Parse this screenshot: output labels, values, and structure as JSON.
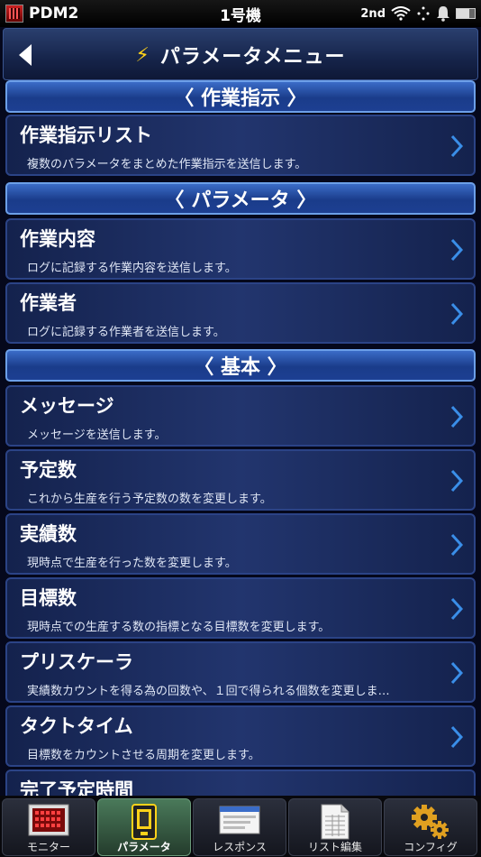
{
  "status_bar": {
    "app_name": "PDM2",
    "device": "1号機",
    "network": "2nd"
  },
  "header": {
    "title": "パラメータメニュー"
  },
  "sections": [
    {
      "title": "〈 作業指示 〉",
      "items": [
        {
          "title": "作業指示リスト",
          "desc": "複数のパラメータをまとめた作業指示を送信します。"
        }
      ]
    },
    {
      "title": "〈 パラメータ 〉",
      "items": [
        {
          "title": "作業内容",
          "desc": "ログに記録する作業内容を送信します。"
        },
        {
          "title": "作業者",
          "desc": "ログに記録する作業者を送信します。"
        }
      ]
    },
    {
      "title": "〈 基本 〉",
      "items": [
        {
          "title": "メッセージ",
          "desc": "メッセージを送信します。"
        },
        {
          "title": "予定数",
          "desc": "これから生産を行う予定数の数を変更します。"
        },
        {
          "title": "実績数",
          "desc": "現時点で生産を行った数を変更します。"
        },
        {
          "title": "目標数",
          "desc": "現時点での生産する数の指標となる目標数を変更します。"
        },
        {
          "title": "プリスケーラ",
          "desc": "実績数カウントを得る為の回数や、１回で得られる個数を変更しま…"
        },
        {
          "title": "タクトタイム",
          "desc": "目標数をカウントさせる周期を変更します。"
        },
        {
          "title": "完了予定時間",
          "desc": ""
        }
      ]
    }
  ],
  "tabs": [
    {
      "label": "モニター",
      "icon": "monitor-icon",
      "active": false
    },
    {
      "label": "パラメータ",
      "icon": "parameter-icon",
      "active": true
    },
    {
      "label": "レスポンス",
      "icon": "response-icon",
      "active": false
    },
    {
      "label": "リスト編集",
      "icon": "list-edit-icon",
      "active": false
    },
    {
      "label": "コンフィグ",
      "icon": "config-gears-icon",
      "active": false
    }
  ],
  "colors": {
    "accent": "#1a3c8a",
    "section_border": "#6c9fe8",
    "bolt": "#ffd21a",
    "chevron": "#3a8ee8"
  }
}
